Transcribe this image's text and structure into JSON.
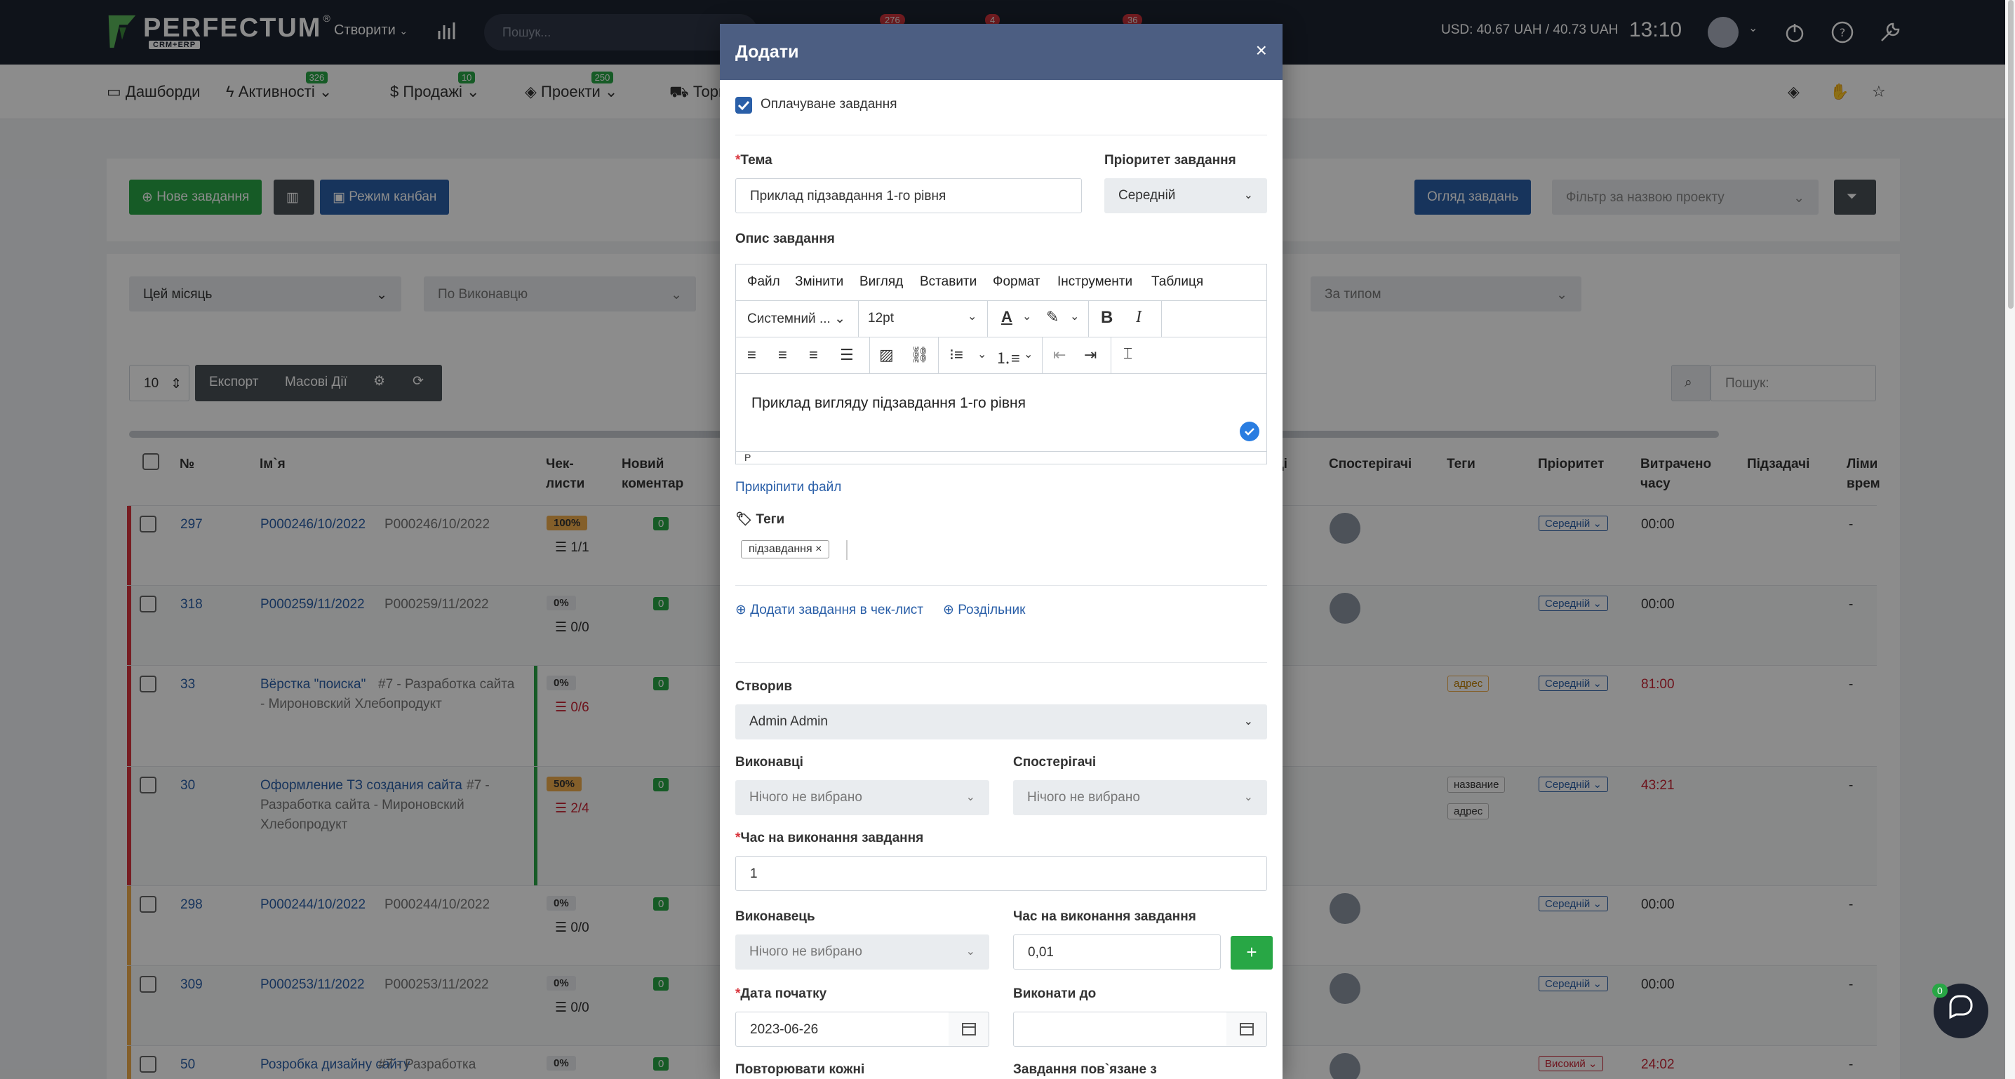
{
  "topbar": {
    "logo": "PERFECTUM",
    "logo_reg": "®",
    "logo_sub": "CRM+ERP",
    "create_label": "Створити",
    "search_placeholder": "Пошук...",
    "badges": [
      "276",
      "4",
      "36"
    ],
    "rate": "USD: 40.67 UAH / 40.73 UAH",
    "clock": "13:10"
  },
  "nav": {
    "items": [
      {
        "label": "Дашборди"
      },
      {
        "label": "Активності",
        "badge": "326"
      },
      {
        "label": "Продажі",
        "badge": "10"
      },
      {
        "label": "Проекти",
        "badge": "250"
      },
      {
        "label": "Торг"
      }
    ]
  },
  "toolbar": {
    "new_task": "Нове завдання",
    "kanban": "Режим канбан",
    "overview": "Огляд завдань",
    "project_filter_placeholder": "Фільтр за назвою проекту"
  },
  "filters": {
    "period": "Цей місяць",
    "assignee": "По Виконавцю",
    "type": "За типом"
  },
  "table_controls": {
    "page_size": "10",
    "export": "Експорт",
    "bulk": "Масові Дії",
    "search_label": "Пошук:"
  },
  "table": {
    "headers": {
      "num": "№",
      "name": "Ім`я",
      "checklists_1": "Чек-",
      "checklists_2": "листи",
      "comment_1": "Новий",
      "comment_2": "коментар",
      "assignees_tail": "ці",
      "watchers": "Спостерігачі",
      "tags": "Теги",
      "priority": "Пріоритет",
      "spent_1": "Витрачено",
      "spent_2": "часу",
      "subtasks": "Підзадачі",
      "limit_1": "Ліми",
      "limit_2": "врем"
    },
    "rows": [
      {
        "num": "297",
        "name": "P000246/10/2022",
        "desc": "P000246/10/2022",
        "desc2": "",
        "desc3": "",
        "pct": "100%",
        "check": "1/1",
        "comments": "0",
        "tags": [],
        "priority": "Середній",
        "spent": "00:00",
        "limit": "-"
      },
      {
        "num": "318",
        "name": "P000259/11/2022",
        "desc": "P000259/11/2022",
        "desc2": "",
        "desc3": "",
        "pct": "0%",
        "check": "0/0",
        "comments": "0",
        "tags": [],
        "priority": "Середній",
        "spent": "00:00",
        "limit": "-"
      },
      {
        "num": "33",
        "name": "Вёрстка \"поиска\"",
        "desc": "#7 - Разработка сайта",
        "desc2": "- Мироновский Хлебопродукт",
        "desc3": "",
        "pct": "0%",
        "check": "0/6",
        "comments": "0",
        "tags": [
          "адрес"
        ],
        "priority": "Середній",
        "spent": "81:00",
        "limit": "-"
      },
      {
        "num": "30",
        "name": "Оформление ТЗ создания сайта",
        "desc": "#7 -",
        "desc2": "Разработка сайта - Мироновский",
        "desc3": "Хлебопродукт",
        "pct": "50%",
        "check": "2/4",
        "comments": "0",
        "tags": [
          "название",
          "адрес"
        ],
        "priority": "Середній",
        "spent": "43:21",
        "limit": "-"
      },
      {
        "num": "298",
        "name": "P000244/10/2022",
        "desc": "P000244/10/2022",
        "desc2": "",
        "desc3": "",
        "pct": "0%",
        "check": "0/0",
        "comments": "0",
        "tags": [],
        "priority": "Середній",
        "spent": "00:00",
        "limit": "-"
      },
      {
        "num": "309",
        "name": "P000253/11/2022",
        "desc": "P000253/11/2022",
        "desc2": "",
        "desc3": "",
        "pct": "0%",
        "check": "0/0",
        "comments": "0",
        "tags": [],
        "priority": "Середній",
        "spent": "00:00",
        "limit": "-"
      },
      {
        "num": "50",
        "name": "Розробка дизайну сайту",
        "desc": "#7 - Разработка",
        "desc2": "",
        "desc3": "",
        "pct": "0%",
        "check": "",
        "comments": "0",
        "tags": [],
        "priority": "Високий",
        "spent": "24:02",
        "limit": "-"
      }
    ]
  },
  "chat": {
    "badge": "0"
  },
  "modal": {
    "title": "Додати",
    "close": "×",
    "billable_label": "Оплачуване завдання",
    "subject_label": "Тема",
    "subject_value": "Приклад підзавдання 1-го рівня",
    "priority_label": "Пріоритет завдання",
    "priority_value": "Середній",
    "description_label": "Опис завдання",
    "editor": {
      "menu": [
        "Файл",
        "Змінити",
        "Вигляд",
        "Вставити",
        "Формат",
        "Інструменти",
        "Таблиця"
      ],
      "font_family": "Системний ...",
      "font_size": "12pt",
      "bold": "B",
      "italic": "I",
      "content": "Приклад вигляду підзавдання 1-го рівня",
      "status_path": "P"
    },
    "attach_file": "Прикріпити файл",
    "tags_label": "Теги",
    "tag_value": "підзавдання",
    "tag_remove": "×",
    "add_to_checklist": "Додати завдання в чек-лист",
    "separator": "Роздільник",
    "creator_label": "Створив",
    "creator_value": "Admin Admin",
    "assignees_label": "Виконавці",
    "assignees_value": "Нічого не вибрано",
    "watchers_label": "Спостерігачі",
    "watchers_value": "Нічого не вибрано",
    "time_label": "Час на виконання завдання",
    "time_value": "1",
    "executor_label": "Виконавець",
    "executor_value": "Нічого не вибрано",
    "exec_time_label": "Час на виконання завдання",
    "exec_time_value": "0,01",
    "add_plus": "+",
    "start_date_label": "Дата початку",
    "start_date_value": "2023-06-26",
    "due_label": "Виконати до",
    "due_value": "",
    "repeat_label": "Повторювати кожні",
    "linked_label": "Завдання пов`язане з"
  }
}
